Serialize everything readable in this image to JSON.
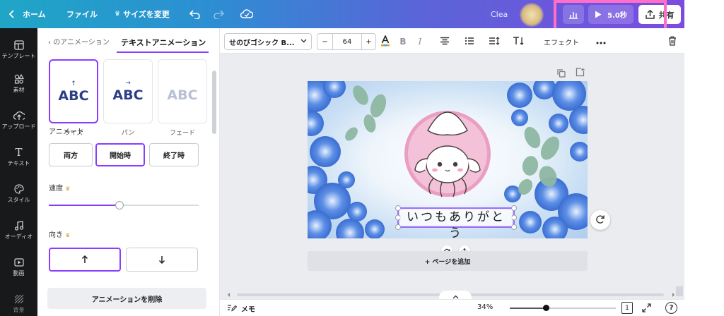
{
  "topbar": {
    "home_label": "ホーム",
    "file_label": "ファイル",
    "resize_label": "サイズを変更",
    "user_partial": "Clea",
    "play_label": "5.0秒",
    "share_label": "共有"
  },
  "rail": {
    "items": [
      {
        "label": "テンプレート",
        "icon": "template-icon"
      },
      {
        "label": "素材",
        "icon": "elements-icon"
      },
      {
        "label": "アップロード",
        "icon": "upload-icon"
      },
      {
        "label": "テキスト",
        "icon": "text-icon"
      },
      {
        "label": "スタイル",
        "icon": "palette-icon"
      },
      {
        "label": "オーディオ",
        "icon": "music-icon"
      },
      {
        "label": "動画",
        "icon": "video-icon"
      },
      {
        "label": "背景",
        "icon": "background-icon"
      }
    ]
  },
  "panel": {
    "back_label": "のアニメーション",
    "tab_label": "テキストアニメーション",
    "presets": [
      {
        "text": "ABC",
        "label": "ライズ",
        "arrow": "↑"
      },
      {
        "text": "ABC",
        "label": "パン",
        "arrow": "→"
      },
      {
        "text": "ABC",
        "label": "フェード",
        "arrow": ""
      }
    ],
    "animate_label": "アニメート",
    "animate_options": [
      "両方",
      "開始時",
      "終了時"
    ],
    "speed_label": "速度",
    "speed_value": 0.47,
    "direction_label": "向き",
    "remove_label": "アニメーションを削除"
  },
  "toolbar": {
    "font_name": "せのびゴシック B...",
    "font_size": "64",
    "minus": "−",
    "plus": "+",
    "bold": "B",
    "italic": "I",
    "effects_label": "エフェクト"
  },
  "canvas": {
    "text": "いつもありがとう",
    "add_page_label": "+ ページを追加"
  },
  "bottombar": {
    "notes_label": "メモ",
    "zoom_label": "34%",
    "zoom_value": 0.34,
    "page_count": "1",
    "help": "?"
  },
  "colors": {
    "accent": "#8b3dff",
    "highlight": "#ff6ec7"
  }
}
